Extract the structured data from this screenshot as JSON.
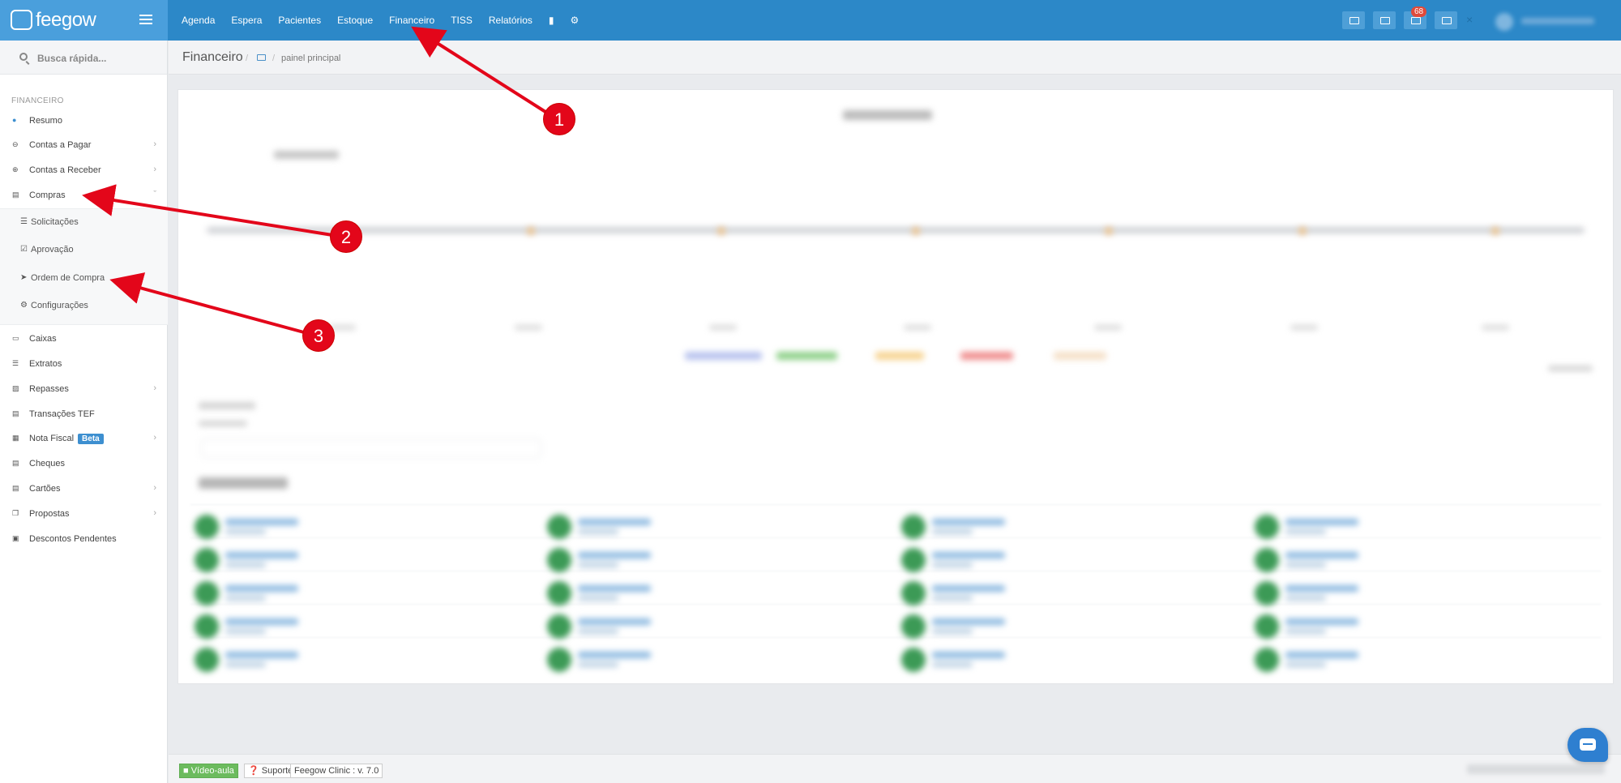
{
  "brand": {
    "logo_text": "feegow",
    "menu_icon": "hamburger-icon"
  },
  "topnav": {
    "items": [
      "Agenda",
      "Espera",
      "Pacientes",
      "Estoque",
      "Financeiro",
      "TISS",
      "Relatórios"
    ],
    "icons": [
      "database-icon",
      "gear-icon"
    ]
  },
  "topright": {
    "notification_count": "68",
    "close_glyph": "×"
  },
  "search": {
    "placeholder": "Busca rápida..."
  },
  "sidebar": {
    "category": "FINANCEIRO",
    "items": [
      {
        "label": "Resumo",
        "icon": "pie-chart-icon"
      },
      {
        "label": "Contas a Pagar",
        "icon": "minus-circle-icon"
      },
      {
        "label": "Contas a Receber",
        "icon": "plus-circle-icon"
      },
      {
        "label": "Compras",
        "icon": "cart-icon"
      },
      {
        "label": "Caixas",
        "icon": "inbox-icon"
      },
      {
        "label": "Extratos",
        "icon": "list-icon"
      },
      {
        "label": "Repasses",
        "icon": "sitemap-icon"
      },
      {
        "label": "Transações TEF",
        "icon": "credit-card-icon"
      },
      {
        "label": "Nota Fiscal",
        "icon": "file-icon",
        "badge": "Beta"
      },
      {
        "label": "Cheques",
        "icon": "cheque-icon"
      },
      {
        "label": "Cartões",
        "icon": "card-icon"
      },
      {
        "label": "Propostas",
        "icon": "copy-icon"
      },
      {
        "label": "Descontos Pendentes",
        "icon": "money-icon"
      }
    ],
    "compras_sub": [
      {
        "label": "Solicitações",
        "icon": "list-icon"
      },
      {
        "label": "Aprovação",
        "icon": "check-square-icon"
      },
      {
        "label": "Ordem de Compra",
        "icon": "send-icon"
      },
      {
        "label": "Configurações",
        "icon": "gear-icon"
      }
    ]
  },
  "header": {
    "title": "Financeiro",
    "separator": "/",
    "crumb": "painel principal"
  },
  "footer": {
    "video": "Vídeo-aula",
    "support": "Suporte",
    "version": "Feegow Clinic : v. 7.0"
  },
  "annotations": [
    "1",
    "2",
    "3"
  ],
  "colors": {
    "topbar": "#2c88c8",
    "brand": "#4a9fdc",
    "annotation": "#e3061a",
    "active_chat": "#2e7fd0"
  }
}
